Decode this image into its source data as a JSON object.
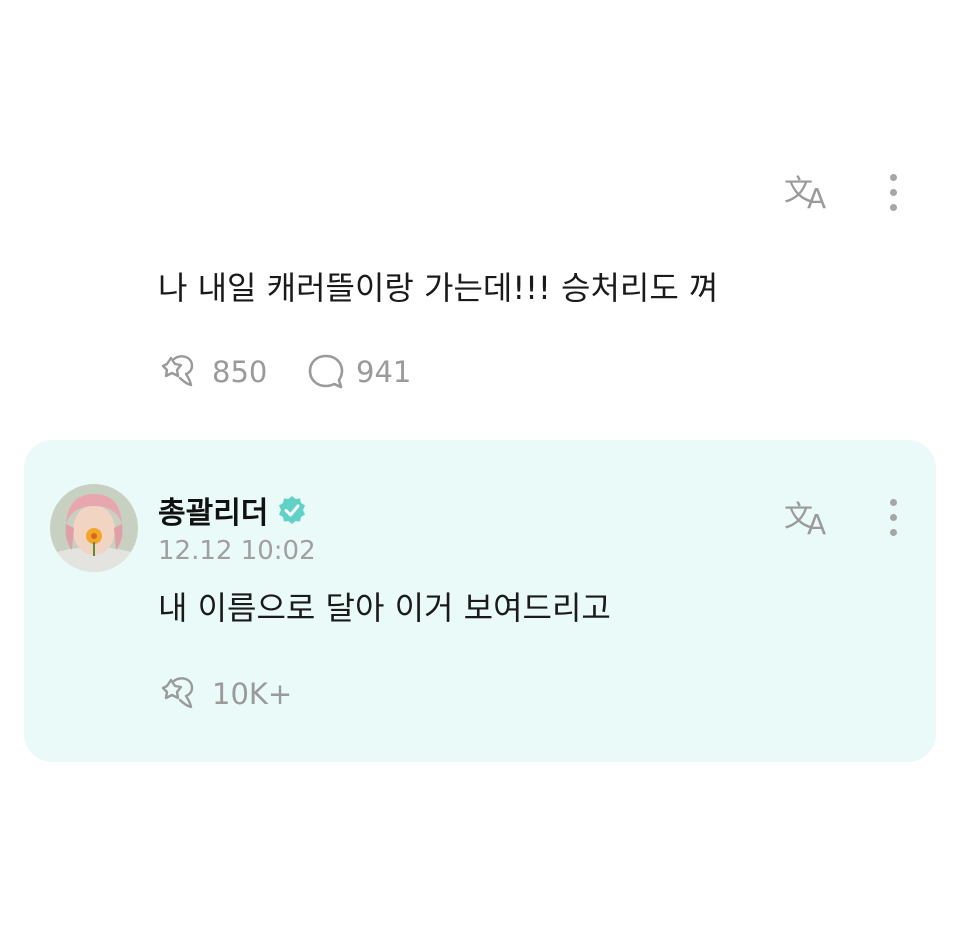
{
  "post": {
    "text": "나 내일 캐러뜰이랑 가는데!!! 승처리도 껴",
    "likes": "850",
    "comments": "941"
  },
  "reply": {
    "author": "총괄리더",
    "verified": true,
    "timestamp": "12.12 10:02",
    "text": "내 이름으로 달아 이거 보여드리고",
    "likes": "10K+"
  },
  "icons": {
    "translate": "translate-icon",
    "more": "more-vertical-icon",
    "like": "like-sparkle-icon",
    "comment": "comment-bubble-icon",
    "verified": "verified-badge-icon"
  },
  "colors": {
    "reply_background": "#eafaf8",
    "verified_badge": "#5fd1c6",
    "muted_text": "#9a9a9a"
  }
}
